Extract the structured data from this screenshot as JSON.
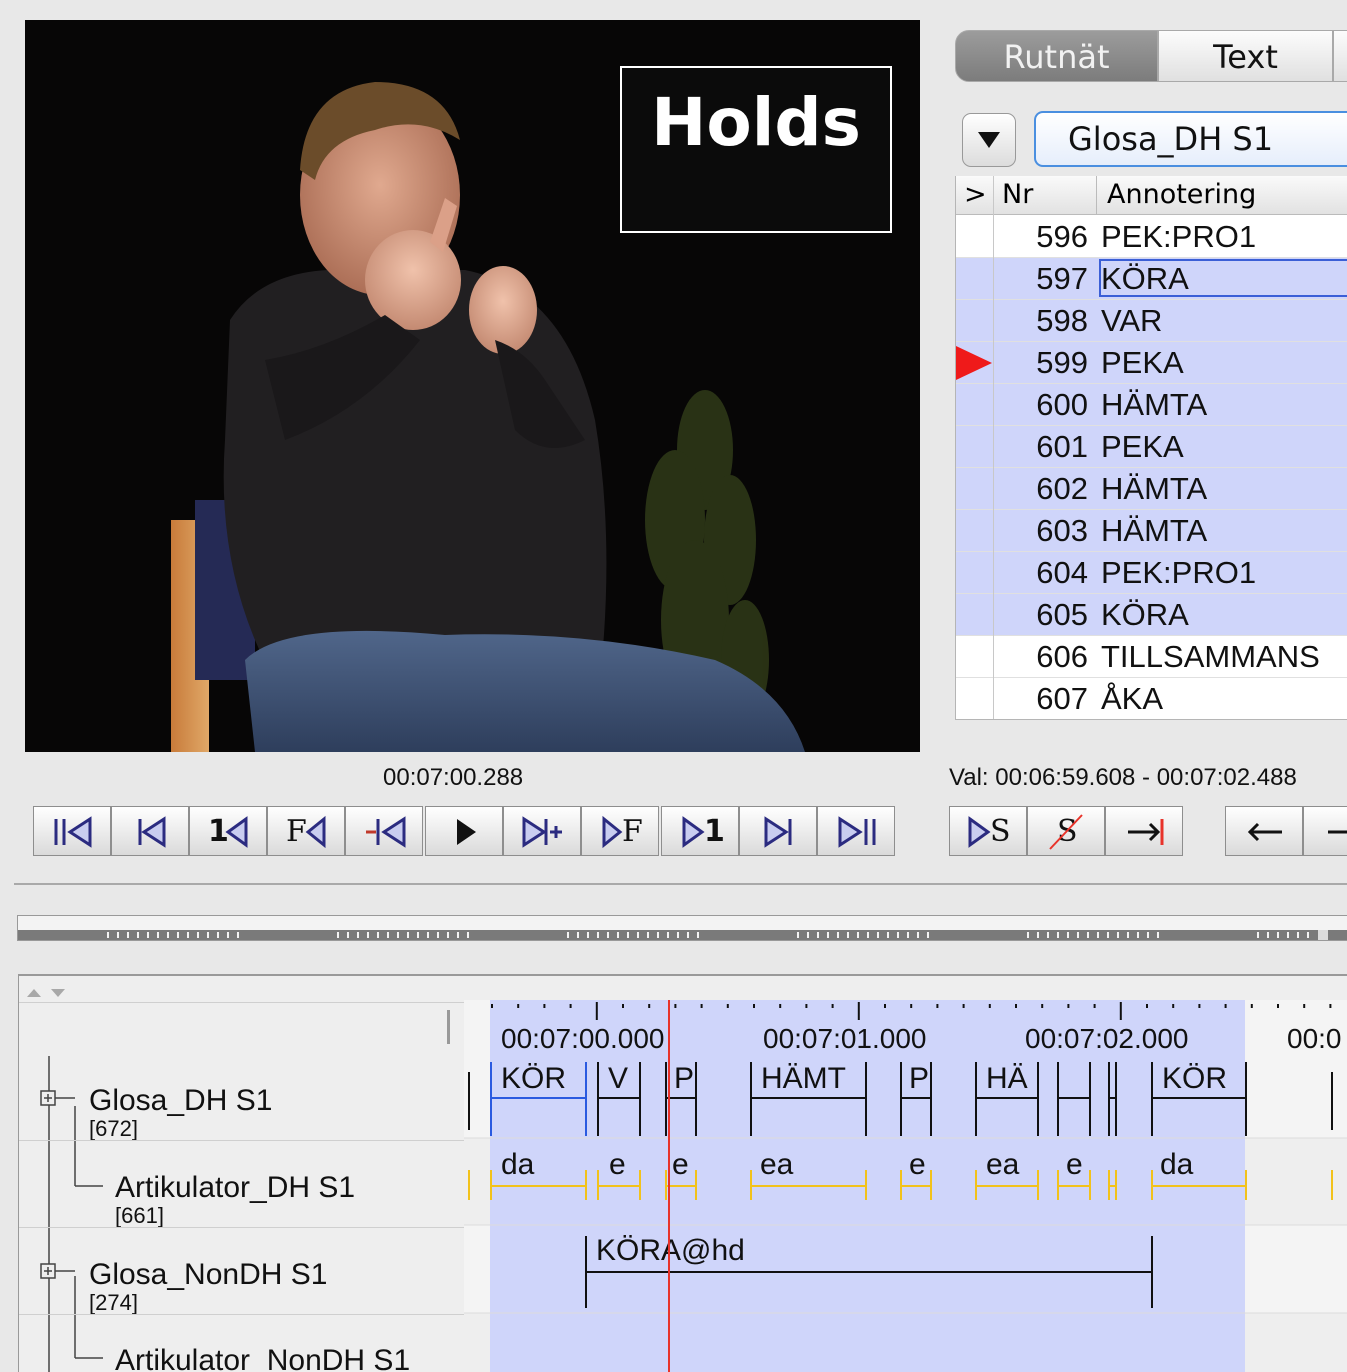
{
  "video": {
    "overlay_title": "Holds"
  },
  "tabs": [
    {
      "label": "Rutnät",
      "active": true
    },
    {
      "label": "Text",
      "active": false
    }
  ],
  "tier_selector": {
    "value": "Glosa_DH S1"
  },
  "grid": {
    "headers": {
      "flag": ">",
      "nr": "Nr",
      "annotation": "Annotering"
    },
    "rows": [
      {
        "nr": "596",
        "annotation": "PEK:PRO1",
        "selected": false,
        "current": false,
        "focused": false
      },
      {
        "nr": "597",
        "annotation": "KÖRA",
        "selected": true,
        "current": false,
        "focused": true
      },
      {
        "nr": "598",
        "annotation": "VAR",
        "selected": true,
        "current": false,
        "focused": false
      },
      {
        "nr": "599",
        "annotation": "PEKA",
        "selected": true,
        "current": true,
        "focused": false
      },
      {
        "nr": "600",
        "annotation": "HÄMTA",
        "selected": true,
        "current": false,
        "focused": false
      },
      {
        "nr": "601",
        "annotation": "PEKA",
        "selected": true,
        "current": false,
        "focused": false
      },
      {
        "nr": "602",
        "annotation": "HÄMTA",
        "selected": true,
        "current": false,
        "focused": false
      },
      {
        "nr": "603",
        "annotation": "HÄMTA",
        "selected": true,
        "current": false,
        "focused": false
      },
      {
        "nr": "604",
        "annotation": "PEK:PRO1",
        "selected": true,
        "current": false,
        "focused": false
      },
      {
        "nr": "605",
        "annotation": "KÖRA",
        "selected": true,
        "current": false,
        "focused": false
      },
      {
        "nr": "606",
        "annotation": "TILLSAMMANS",
        "selected": false,
        "current": false,
        "focused": false
      },
      {
        "nr": "607",
        "annotation": "ÅKA",
        "selected": false,
        "current": false,
        "focused": false
      }
    ]
  },
  "player": {
    "current_time": "00:07:00.288",
    "selection": "Val: 00:06:59.608 - 00:07:02.488"
  },
  "transport_buttons": [
    {
      "name": "go-to-begin-button",
      "icon": "skip-to-start-icon"
    },
    {
      "name": "previous-scrollview-button",
      "icon": "previous-page-icon"
    },
    {
      "name": "previous-second-button",
      "icon": "back-one-second-icon",
      "label": "1"
    },
    {
      "name": "previous-frame-button",
      "icon": "back-frame-icon",
      "label": "F"
    },
    {
      "name": "previous-pixel-button",
      "icon": "back-pixel-icon"
    },
    {
      "name": "play-pause-button",
      "icon": "play-icon"
    },
    {
      "name": "next-pixel-button",
      "icon": "forward-pixel-icon"
    },
    {
      "name": "next-frame-button",
      "icon": "forward-frame-icon",
      "label": "F"
    },
    {
      "name": "next-second-button",
      "icon": "forward-one-second-icon",
      "label": "1"
    },
    {
      "name": "next-scrollview-button",
      "icon": "next-page-icon"
    },
    {
      "name": "go-to-end-button",
      "icon": "skip-to-end-icon"
    }
  ],
  "selection_buttons": [
    {
      "name": "play-selection-button",
      "icon": "play-selection-icon",
      "label": "S"
    },
    {
      "name": "clear-selection-button",
      "icon": "clear-selection-icon",
      "label": "S"
    },
    {
      "name": "to-selection-end-button",
      "icon": "to-boundary-icon"
    },
    {
      "name": "selection-left-button",
      "icon": "arrow-left-icon"
    },
    {
      "name": "selection-right-button",
      "icon": "arrow-right-icon"
    }
  ],
  "timeline": {
    "time_labels": [
      "00:07:00.000",
      "00:07:01.000",
      "00:07:02.000",
      "00:0"
    ],
    "tiers": [
      {
        "name": "Glosa_DH S1",
        "count": "[672]",
        "child": false
      },
      {
        "name": "Artikulator_DH S1",
        "count": "[661]",
        "child": true
      },
      {
        "name": "Glosa_NonDH S1",
        "count": "[274]",
        "child": false
      },
      {
        "name": "Artikulator_NonDH S1",
        "count": "",
        "child": true
      }
    ],
    "glosa_dh_labels": [
      "KÖR",
      "V",
      "P",
      "HÄMT",
      "P",
      "HÄ",
      "KÖR"
    ],
    "artikulator_dh_labels": [
      "da",
      "e",
      "e",
      "ea",
      "e",
      "ea",
      "e",
      "da"
    ],
    "glosa_nondh_labels": [
      "KÖRA@hd"
    ],
    "colors": {
      "selection": "#cfd5fa",
      "crosshair": "#e8332a",
      "articulator": "#f2c21b",
      "active_annotation": "#2a5ae0"
    }
  }
}
